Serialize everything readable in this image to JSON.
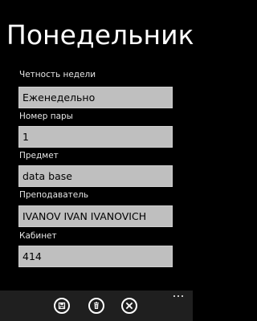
{
  "page": {
    "title": "Понедельник"
  },
  "fields": [
    {
      "label": "Четность недели",
      "value": "Еженедельно"
    },
    {
      "label": "Номер пары",
      "value": "1"
    },
    {
      "label": "Предмет",
      "value": "data base"
    },
    {
      "label": "Преподаватель",
      "value": "IVANOV IVAN IVANOVICH"
    },
    {
      "label": "Кабинет",
      "value": "414"
    }
  ],
  "appbar": {
    "buttons": [
      {
        "icon": "save-icon"
      },
      {
        "icon": "delete-icon"
      },
      {
        "icon": "close-icon"
      }
    ],
    "more_icon": "more-ellipsis-icon"
  },
  "colors": {
    "background": "#000000",
    "field_background": "#bfbfbf",
    "appbar_background": "#1f1f1f",
    "text_primary": "#ffffff"
  }
}
